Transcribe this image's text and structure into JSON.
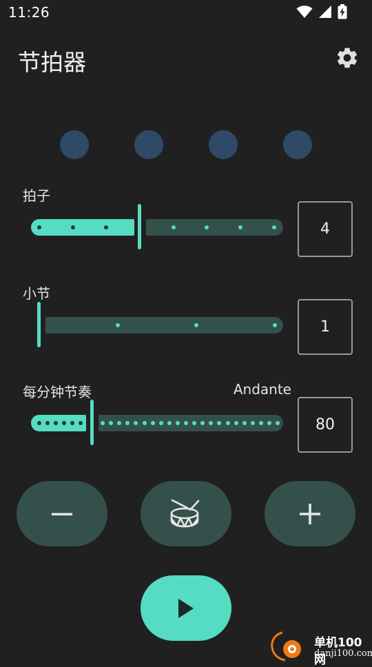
{
  "status": {
    "time": "11:26"
  },
  "app": {
    "title": "节拍器"
  },
  "beats": {
    "count": 4
  },
  "sections": {
    "beats": {
      "label": "拍子",
      "value": "4",
      "slider_fraction": 0.43
    },
    "measure": {
      "label": "小节",
      "value": "1",
      "slider_fraction": 0.0
    },
    "bpm": {
      "label": "每分钟节奏",
      "tempo_name": "Andante",
      "value": "80",
      "slider_fraction": 0.22
    }
  },
  "controls": {
    "minus_icon": "minus-icon",
    "drum_icon": "drum-icon",
    "plus_icon": "plus-icon",
    "play_icon": "play-icon"
  },
  "colors": {
    "accent": "#55dcc3",
    "track_inactive": "#33504a",
    "beat_dot": "#2f4a66",
    "background": "#202020"
  },
  "watermark": {
    "name": "单机100网",
    "url": "danji100.com"
  }
}
